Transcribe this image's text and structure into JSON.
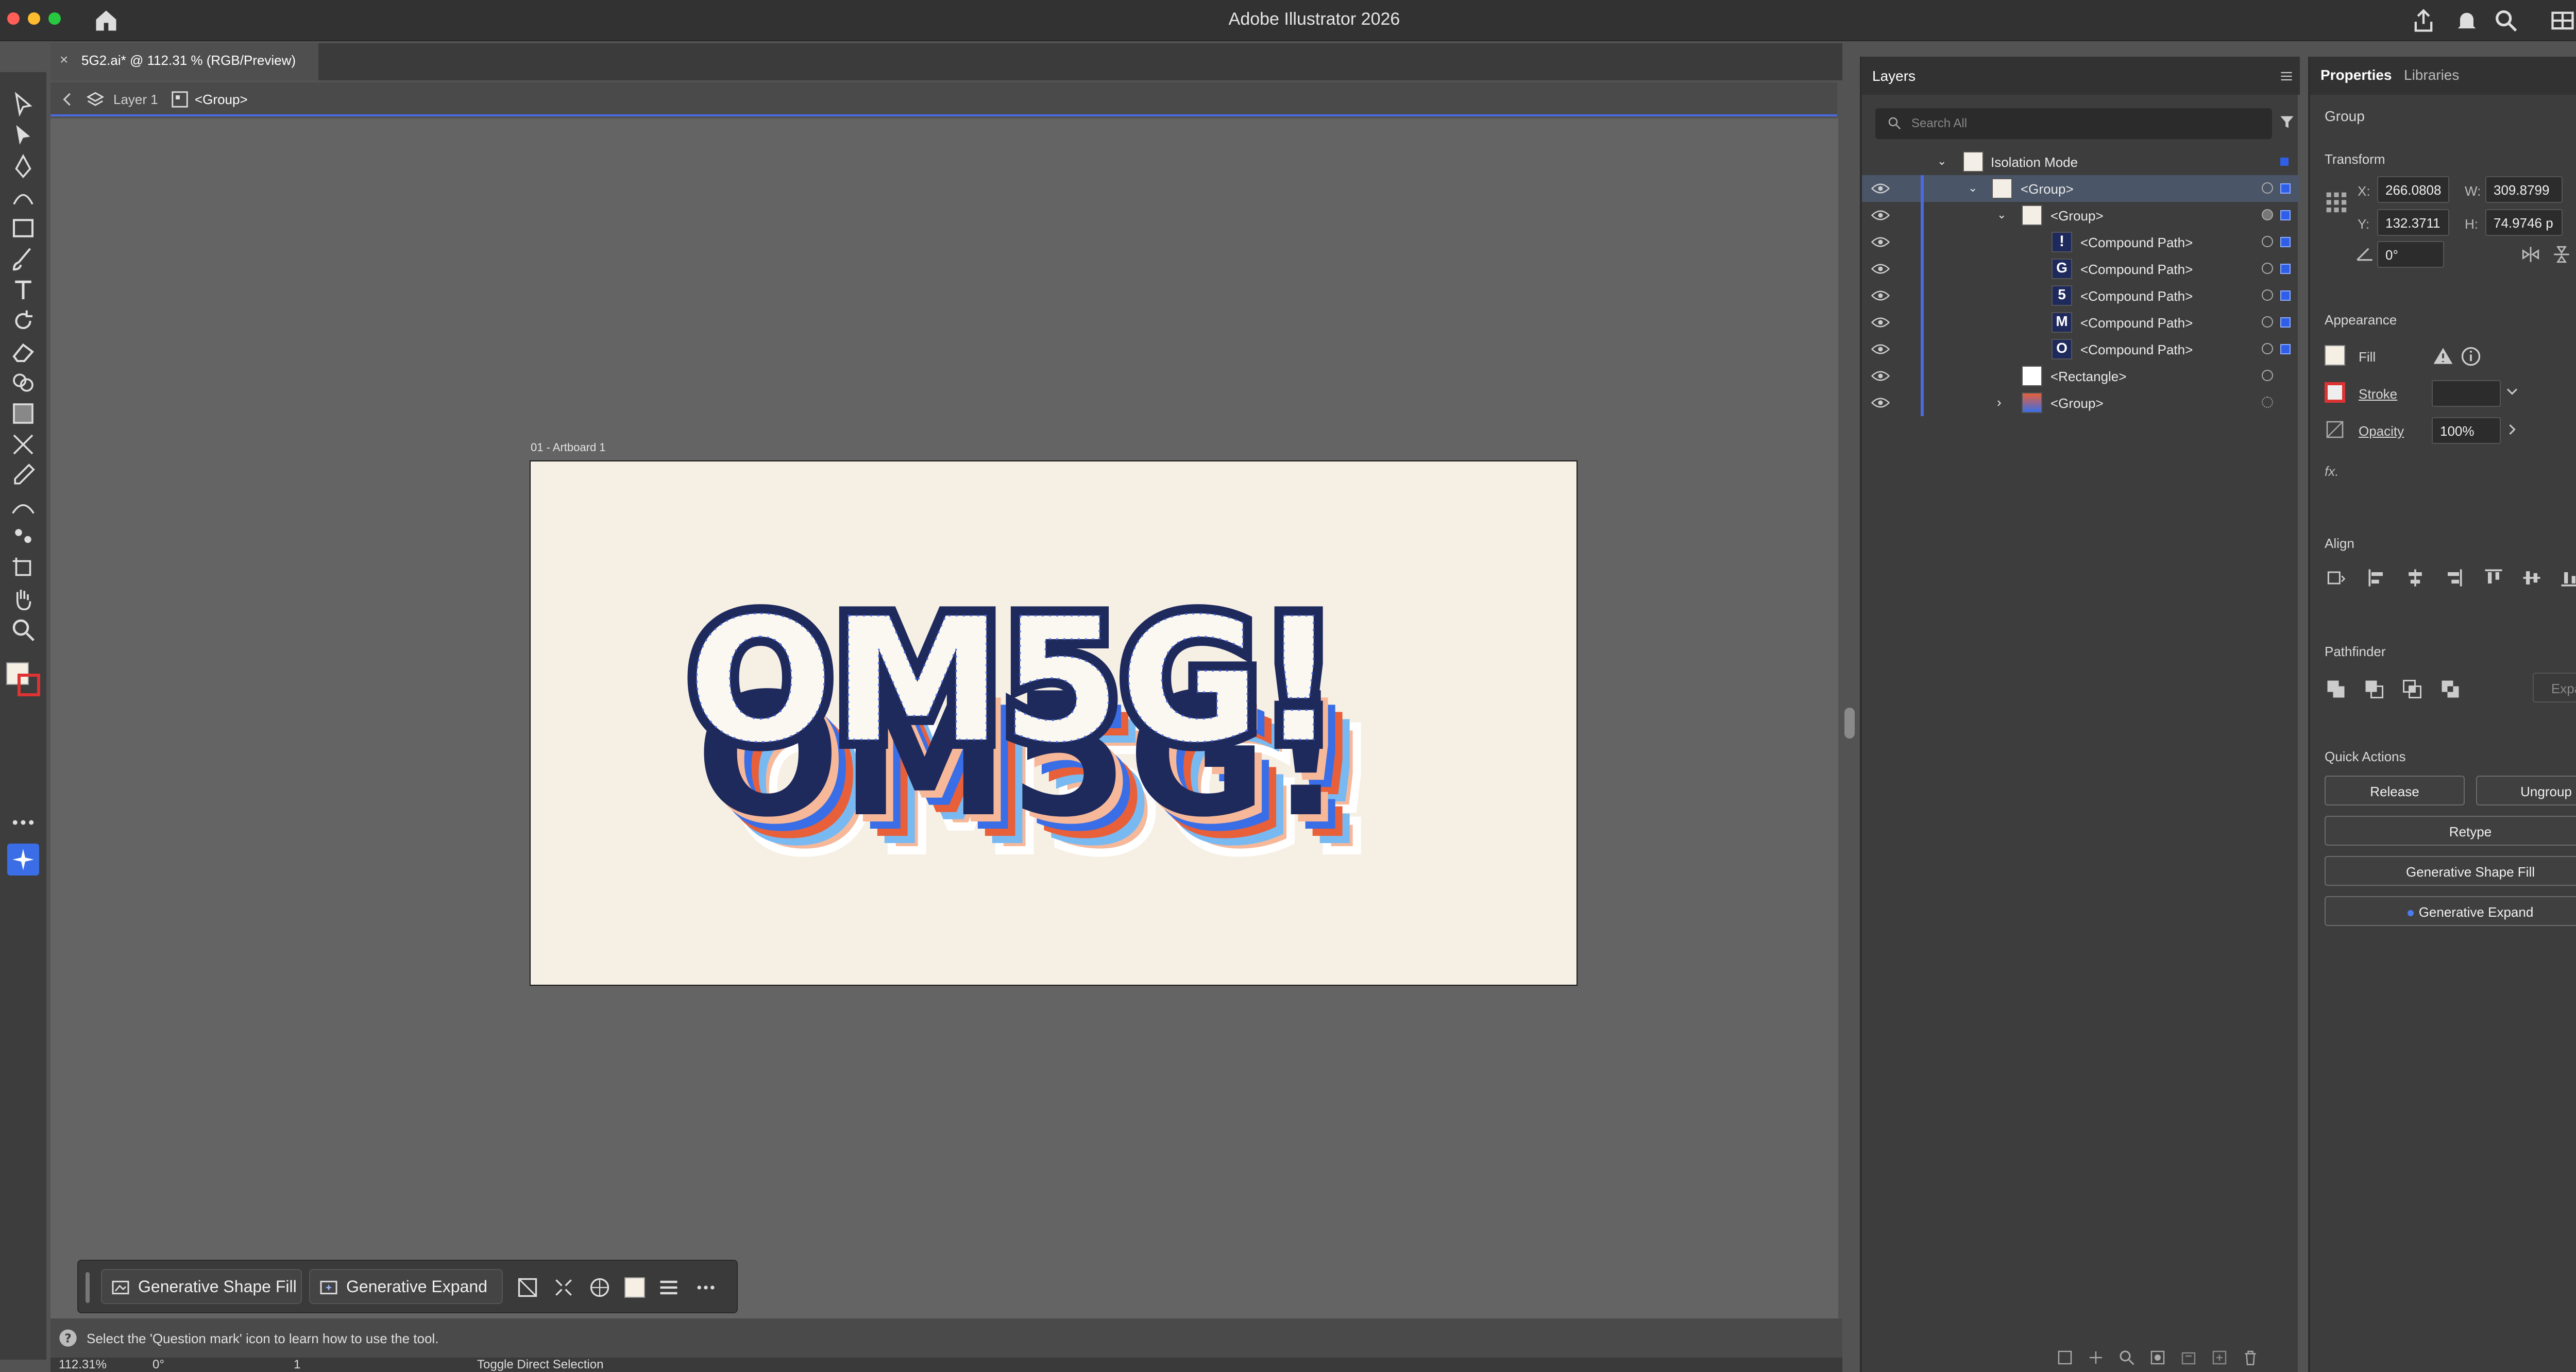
{
  "app": {
    "title": "Adobe Illustrator 2026"
  },
  "tab": {
    "label": "5G2.ai* @ 112.31 % (RGB/Preview)"
  },
  "breadcrumb": {
    "layer": "Layer 1",
    "group": "<Group>"
  },
  "artboard": {
    "label": "01 - Artboard 1",
    "art_text": "OM5G!"
  },
  "context_bar": {
    "gen_shape_fill": "Generative Shape Fill",
    "gen_expand": "Generative Expand"
  },
  "status": {
    "hint": "Select the 'Question mark' icon to learn how to use the tool.",
    "zoom": "112.31%",
    "rotation": "0°",
    "artboard_num": "1",
    "toggle": "Toggle Direct Selection"
  },
  "layers": {
    "title": "Layers",
    "search_placeholder": "Search All",
    "rows": [
      {
        "label": "Isolation Mode"
      },
      {
        "label": "<Group>"
      },
      {
        "label": "<Group>"
      },
      {
        "label": "<Compound Path>"
      },
      {
        "label": "<Compound Path>"
      },
      {
        "label": "<Compound Path>"
      },
      {
        "label": "<Compound Path>"
      },
      {
        "label": "<Compound Path>"
      },
      {
        "label": "<Rectangle>"
      },
      {
        "label": "<Group>"
      }
    ]
  },
  "properties": {
    "tab_properties": "Properties",
    "tab_libraries": "Libraries",
    "type": "Group",
    "transform": {
      "title": "Transform",
      "x_label": "X:",
      "x": "266.0808",
      "y_label": "Y:",
      "y": "132.3711",
      "w_label": "W:",
      "w": "309.8799",
      "h_label": "H:",
      "h": "74.9746 p",
      "angle": "0°"
    },
    "appearance": {
      "title": "Appearance",
      "fill": "Fill",
      "stroke": "Stroke",
      "opacity": "Opacity",
      "opacity_value": "100%",
      "fx": "fx."
    },
    "align": {
      "title": "Align"
    },
    "pathfinder": {
      "title": "Pathfinder",
      "expand": "Expand"
    },
    "quick_actions": {
      "title": "Quick Actions",
      "release": "Release",
      "ungroup": "Ungroup",
      "retype": "Retype",
      "gen_shape_fill": "Generative Shape Fill",
      "gen_expand": "Generative Expand"
    }
  },
  "colors": {
    "accent": "#4a6ae0",
    "navy": "#1f2a5c",
    "orange": "#e8603a",
    "lightblue": "#79b9f2",
    "blue": "#3a6ee6",
    "peach": "#f4b79a",
    "artboard": "#f6efe4"
  }
}
